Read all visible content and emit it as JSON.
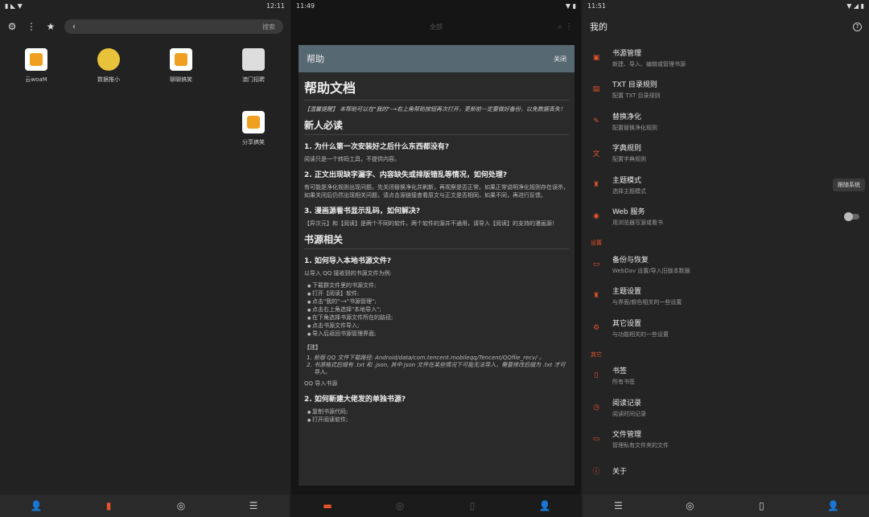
{
  "p1": {
    "time": "12:11",
    "search_placeholder": "搜索",
    "books": [
      {
        "title": "云woaM",
        "kind": "rss"
      },
      {
        "title": "数据推小",
        "kind": "img"
      },
      {
        "title": "聊聊搞笑",
        "kind": "rss"
      },
      {
        "title": "澳门招聘",
        "kind": "img2"
      },
      {
        "title": "",
        "kind": "none"
      },
      {
        "title": "",
        "kind": "none"
      },
      {
        "title": "",
        "kind": "none"
      },
      {
        "title": "分享搞笑",
        "kind": "rss"
      }
    ]
  },
  "p2": {
    "time": "11:49",
    "header": "全部",
    "dialog_title": "帮助",
    "close": "关闭",
    "doc_title": "帮助文档",
    "intro": "【温馨提醒】 本帮助可以在\"我的\"-→右上角帮助按钮再次打开，更新前一定要做好备份，以免数据丢失！",
    "sec1": "新人必读",
    "q1": "1. 为什么第一次安装好之后什么东西都没有?",
    "a1": "阅读只是一个转码工具，不提供内容。",
    "q2": "2. 正文出现缺字漏字、内容缺失或排版错乱等情况，如何处理?",
    "a2": "有可能是净化规则出现问题，先关闭替换净化并刷新，再观察是否正常。如果正常说明净化规则存在误杀，如果关闭后仍然出现相关问题，请点击源链接查看原文与正文是否相同，如果不同，再进行反馈。",
    "q3": "3. 漫画源看书显示乱码，如何解决?",
    "a3": "【异次元】和【阅读】是两个不同的软件，两个软件的源并不通用，请导入【阅读】的支持的漫画源！",
    "sec2": "书源相关",
    "q4": "1. 如何导入本地书源文件?",
    "a4": "以导入 QQ 接收到的书源文件为例:",
    "steps": [
      "下载群文件里的书源文件;",
      "打开【阅读】软件;",
      "点击\"我的\"-→\"书源管理\";",
      "点击右上角选择\"本地导入\";",
      "在下角选择书源文件所在的路径;",
      "点击书源文件导入;",
      "导入后返回书源管理界面;"
    ],
    "note": "【注】",
    "notes": [
      "新版 QQ 文件下载路径: Android/data/com.tencent.mobileqq/Tencent/QQfile_recv/ 。",
      "书源格式后缀有 .txt 和 .json, 其中 json 文件在某些情况下可能无法导入，需要修改后缀为 .txt 才可导入。"
    ],
    "qq": "QQ 导入书源",
    "q5": "2. 如何新建大佬发的单独书源?",
    "steps2": [
      "复制书源代码;",
      "打开阅读软件;"
    ]
  },
  "p3": {
    "time": "11:51",
    "title": "我的",
    "help": "?",
    "items": [
      {
        "title": "书源管理",
        "sub": "新建、导入、编辑或管理书源",
        "icon": "▣"
      },
      {
        "title": "TXT 目录规则",
        "sub": "配置 TXT 目录规则",
        "icon": "▤"
      },
      {
        "title": "替换净化",
        "sub": "配置替换净化规则",
        "icon": "✎"
      },
      {
        "title": "字典规则",
        "sub": "配置字典规则",
        "icon": "文"
      },
      {
        "title": "主题模式",
        "sub": "选择主题模式",
        "icon": "♜",
        "badge": "跟随系统"
      },
      {
        "title": "Web 服务",
        "sub": "用浏览器写源或看书",
        "icon": "◉",
        "toggle": "off"
      }
    ],
    "sec_settings": "设置",
    "items2": [
      {
        "title": "备份与恢复",
        "sub": "WebDav 设置/导入旧版本数据",
        "icon": "▭"
      },
      {
        "title": "主题设置",
        "sub": "与界面/颜色相关的一些设置",
        "icon": "♜"
      },
      {
        "title": "其它设置",
        "sub": "与功能相关的一些设置",
        "icon": "⚙"
      }
    ],
    "sec_other": "其它",
    "items3": [
      {
        "title": "书签",
        "sub": "所有书签",
        "icon": "▯"
      },
      {
        "title": "阅读记录",
        "sub": "阅读时间记录",
        "icon": "◷"
      },
      {
        "title": "文件管理",
        "sub": "管理私有文件夹的文件",
        "icon": "▭"
      },
      {
        "title": "关于",
        "sub": "",
        "icon": "ⓘ"
      }
    ]
  }
}
